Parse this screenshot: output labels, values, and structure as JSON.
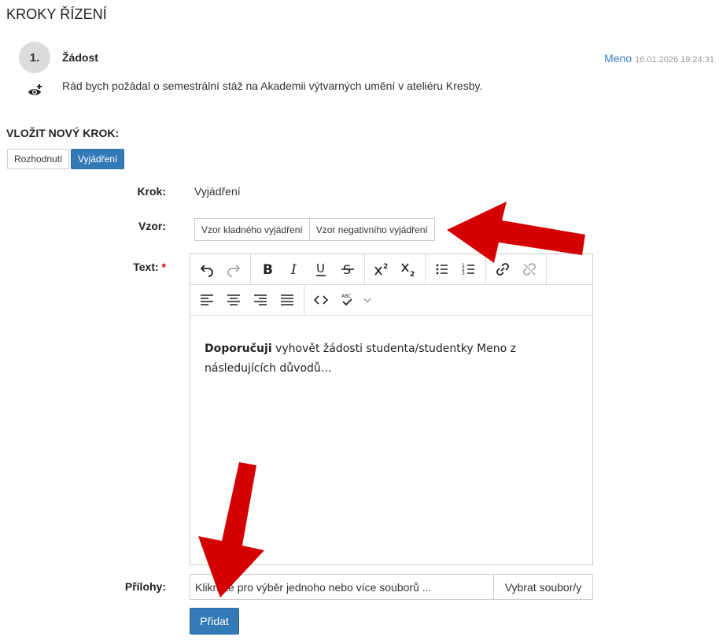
{
  "section_title": "KROKY ŘÍZENÍ",
  "step": {
    "number": "1.",
    "title": "Žádost",
    "user": "Meno",
    "date": "16.01.2026 19:24:31",
    "text": "Rád bych požádal o semestrální stáž na Akademii výtvarných umění v ateliéru Kresby."
  },
  "new_step": {
    "heading": "VLOŽIT NOVÝ KROK:",
    "tabs": [
      "Rozhodnutí",
      "Vyjádření"
    ],
    "active_tab": "Vyjádření"
  },
  "form": {
    "krok_label": "Krok:",
    "krok_value": "Vyjádření",
    "vzor_label": "Vzor:",
    "templates": [
      "Vzor kladného vyjádření",
      "Vzor negativního vyjádření"
    ],
    "text_label": "Text:",
    "required_mark": "*",
    "editor_bold": "Doporučuji",
    "editor_rest": " vyhovět žádosti studenta/studentky Meno z následujících důvodů…",
    "attachments_label": "Přílohy:",
    "file_placeholder": "Klikněte pro výběr jednoho nebo více souborů ...",
    "file_browse": "Vybrat soubor/y",
    "submit": "Přidat"
  },
  "toolbar_icons": [
    "undo-icon",
    "redo-icon",
    "bold-icon",
    "italic-icon",
    "underline-icon",
    "strikethrough-icon",
    "superscript-icon",
    "subscript-icon",
    "bullet-list-icon",
    "numbered-list-icon",
    "link-icon",
    "unlink-icon",
    "align-left-icon",
    "align-center-icon",
    "align-right-icon",
    "justify-icon",
    "code-icon",
    "spellcheck-icon",
    "chevron-down-icon"
  ],
  "colors": {
    "primary": "#337ab7",
    "annotation_arrow": "#d40000",
    "link": "#3a7fc1"
  }
}
